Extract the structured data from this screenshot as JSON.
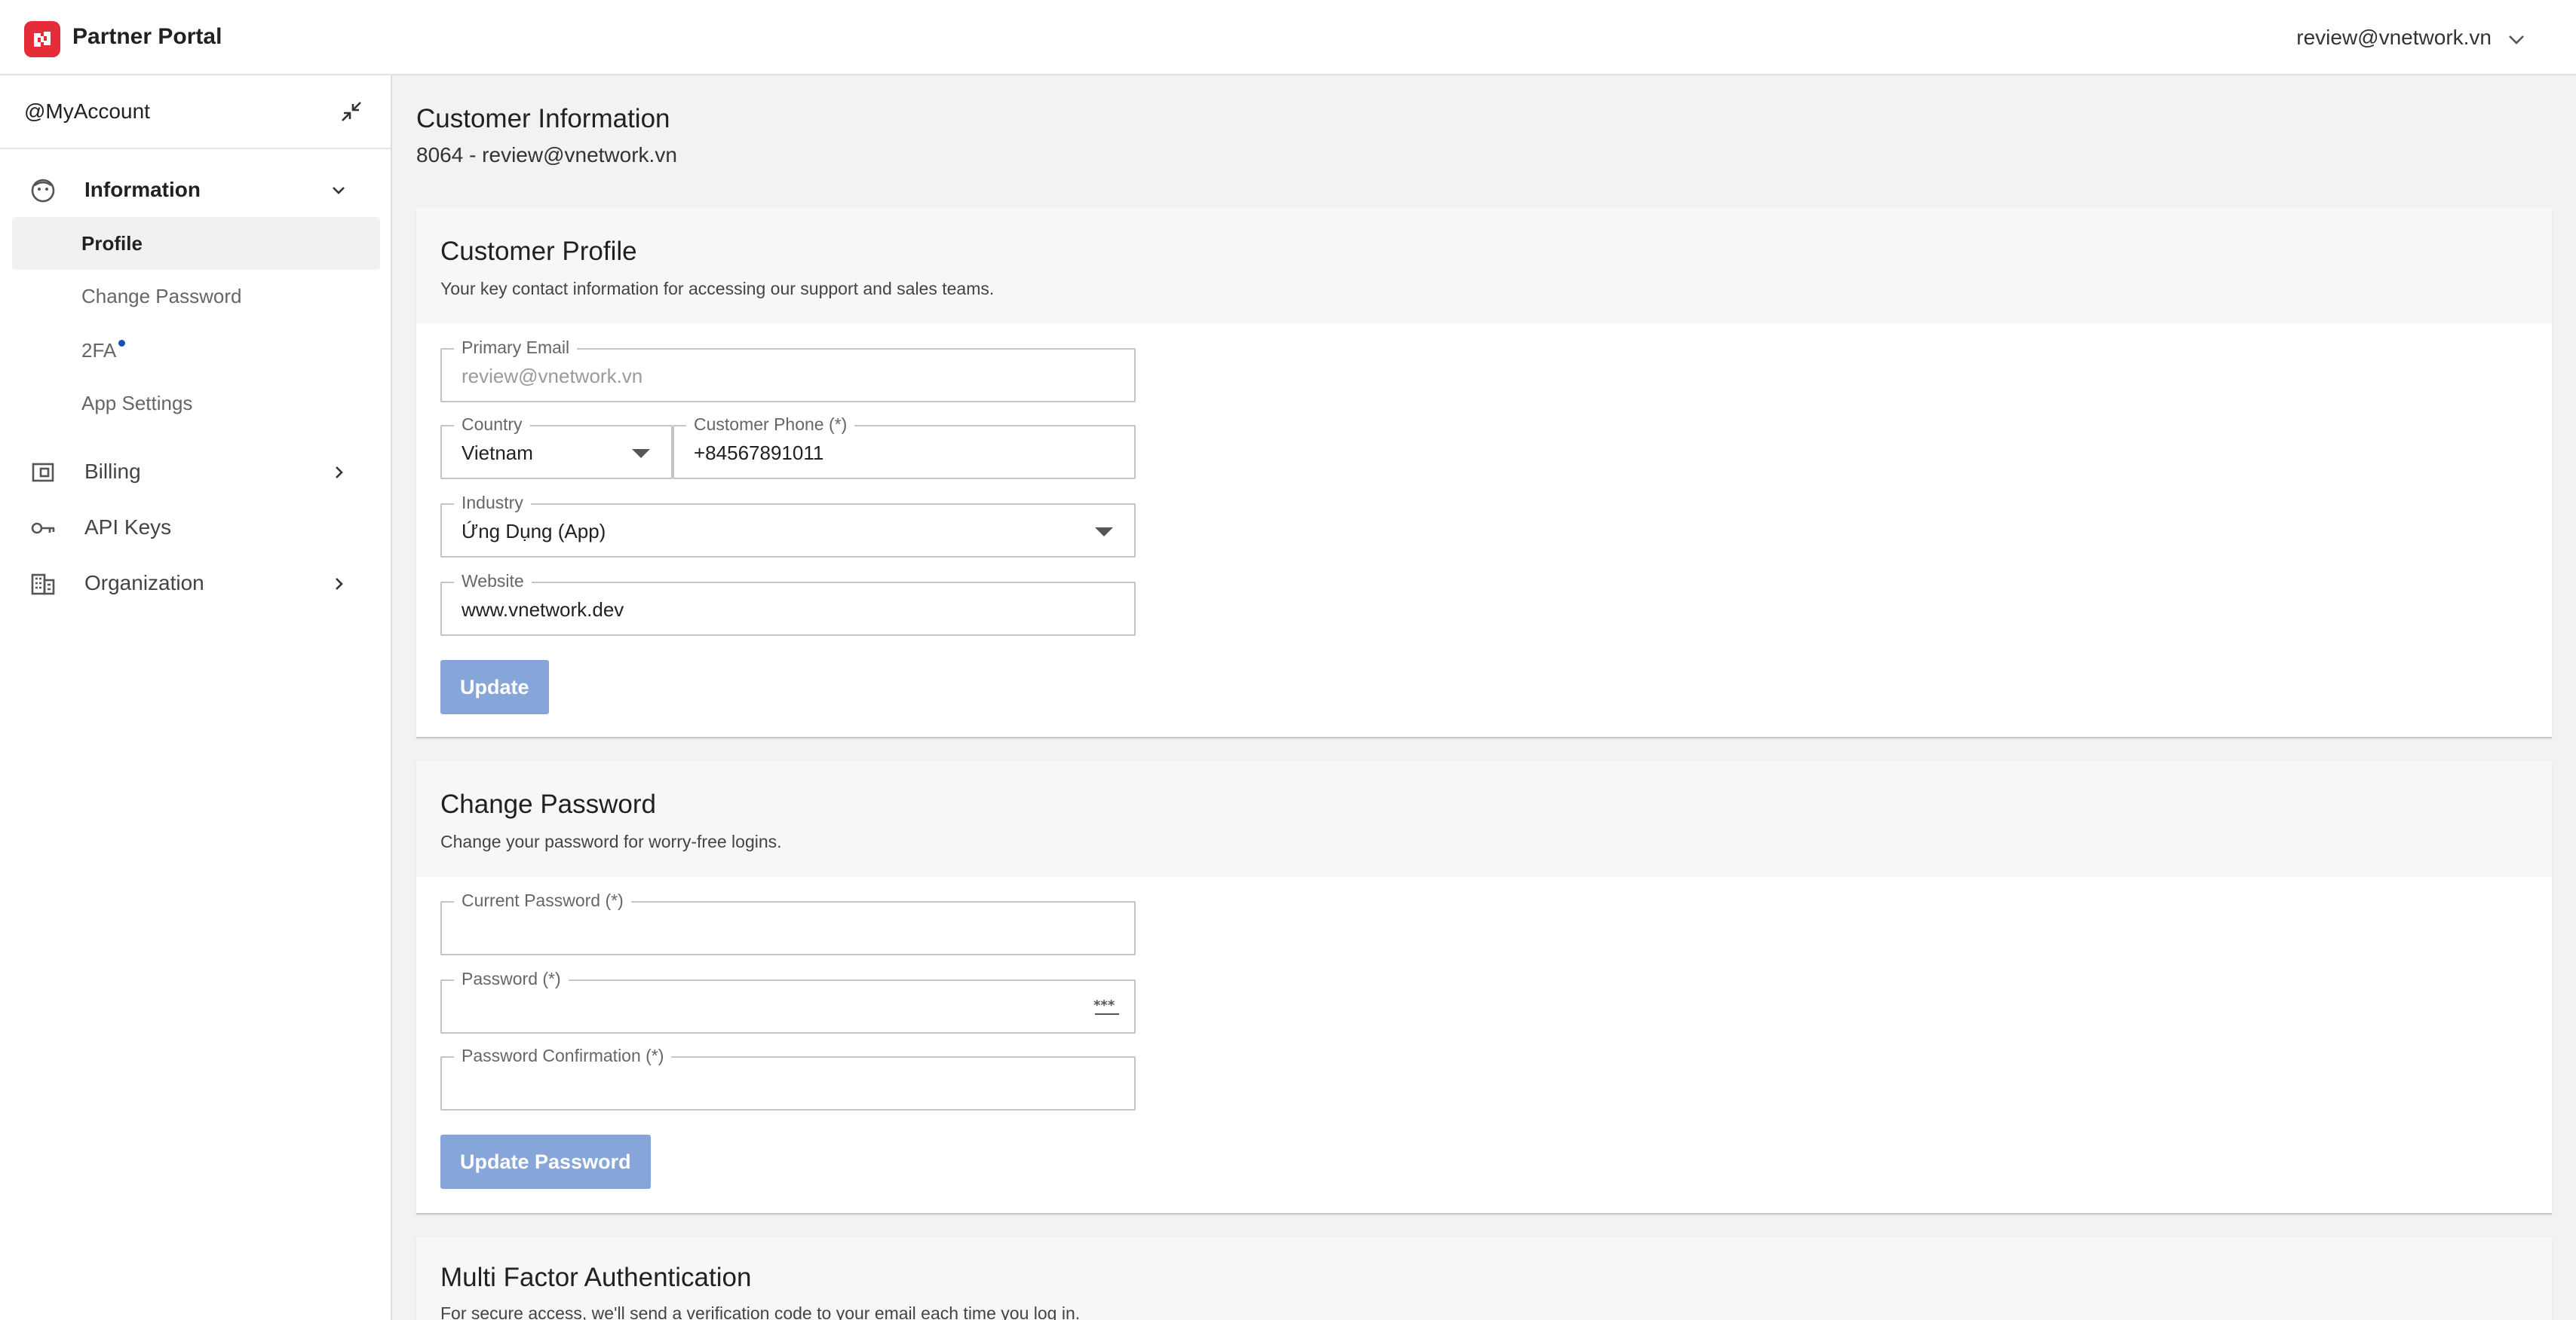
{
  "header": {
    "brand": "Partner Portal",
    "user_email": "review@vnetwork.vn",
    "logo_icon": "brand-logo-icon",
    "chevron_icon": "chevron-down-icon"
  },
  "sidebar": {
    "account_label": "@MyAccount",
    "collapse_icon": "collapse-arrows-icon",
    "groups": [
      {
        "label": "Information",
        "icon": "smiley-face-icon",
        "expanded": true
      },
      {
        "label": "Billing",
        "icon": "wallet-icon",
        "expanded": false
      },
      {
        "label": "API Keys",
        "icon": "key-icon",
        "expanded": false
      },
      {
        "label": "Organization",
        "icon": "building-icon",
        "expanded": false
      }
    ],
    "subitems": [
      {
        "label": "Profile",
        "selected": true
      },
      {
        "label": "Change Password",
        "selected": false
      },
      {
        "label": "2FA",
        "selected": false,
        "badge_dot": true
      },
      {
        "label": "App Settings",
        "selected": false
      }
    ]
  },
  "main": {
    "title": "Customer Information",
    "subtitle": "8064 - review@vnetwork.vn",
    "profile_card": {
      "title": "Customer Profile",
      "description": "Your key contact information for accessing our support and sales teams.",
      "primary_email_label": "Primary Email",
      "primary_email_value": "review@vnetwork.vn",
      "country_label": "Country",
      "country_value": "Vietnam",
      "phone_label": "Customer Phone (*)",
      "phone_value": "+84567891011",
      "industry_label": "Industry",
      "industry_value": "Ứng Dụng (App)",
      "website_label": "Website",
      "website_value": "www.vnetwork.dev",
      "update_label": "Update"
    },
    "password_card": {
      "title": "Change Password",
      "description": "Change your password for worry-free logins.",
      "current_label": "Current Password (*)",
      "password_label": "Password (*)",
      "confirm_label": "Password Confirmation (*)",
      "update_label": "Update Password"
    },
    "mfa_card": {
      "title": "Multi Factor Authentication",
      "description": "For secure access, we'll send a verification code to your email each time you log in."
    }
  },
  "colors": {
    "brand_red": "#e52d3a",
    "button_blue": "#86a6d9",
    "badge_blue": "#1a4fb3"
  }
}
